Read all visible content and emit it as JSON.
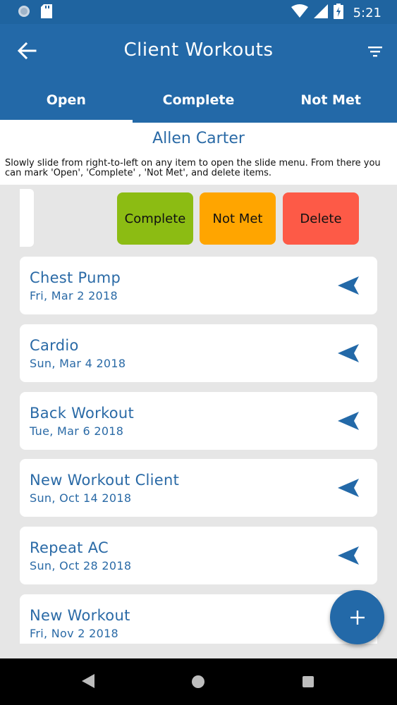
{
  "status_bar": {
    "time": "5:21",
    "icons": [
      "notification-icon",
      "sd-card-icon",
      "wifi-icon",
      "signal-icon",
      "battery-charging-icon"
    ]
  },
  "app_bar": {
    "title": "Client Workouts",
    "back_icon": "arrow-back-icon",
    "filter_icon": "filter-icon"
  },
  "tabs": [
    {
      "label": "Open",
      "active": true
    },
    {
      "label": "Complete",
      "active": false
    },
    {
      "label": "Not Met",
      "active": false
    }
  ],
  "client_name": "Allen Carter",
  "hint": "Slowly slide from right-to-left on any item to open the slide menu. From there you can mark 'Open', 'Complete' , 'Not Met', and delete items.",
  "slide_actions": {
    "complete": "Complete",
    "not_met": "Not Met",
    "delete": "Delete"
  },
  "workouts": [
    {
      "name": "Chest Pump",
      "date": "Fri, Mar 2 2018"
    },
    {
      "name": "Cardio",
      "date": "Sun, Mar 4 2018"
    },
    {
      "name": "Back Workout",
      "date": "Tue, Mar 6 2018"
    },
    {
      "name": "New Workout Client",
      "date": "Sun, Oct 14 2018"
    },
    {
      "name": "Repeat AC",
      "date": "Sun, Oct 28 2018"
    },
    {
      "name": "New Workout",
      "date": "Fri, Nov 2 2018"
    }
  ],
  "colors": {
    "primary": "#2369a8",
    "text_blue": "#2a6aa6",
    "complete": "#8cbc13",
    "not_met": "#ffa500",
    "delete": "#fd5a47"
  }
}
